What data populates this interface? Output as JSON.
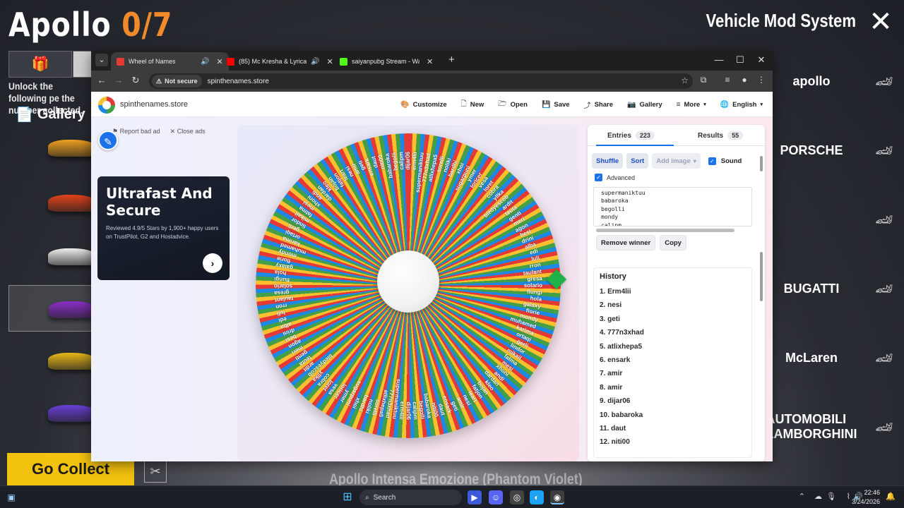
{
  "game": {
    "title_name": "Apollo",
    "title_progress": "0/7",
    "system_title": "Vehicle Mod System",
    "unlock_note": "Unlock the following pe the number collected.",
    "gallery_label": "Gallery",
    "collect_button": "Go Collect",
    "car_caption": "Apollo Intensa Emozione (Phantom Violet)",
    "car_colors": [
      "#f0a020",
      "#e2421b",
      "#eeeeee",
      "#8b2fc9",
      "#e8b81a",
      "#6a3fd8"
    ],
    "brands": [
      {
        "name": "apollo",
        "icon": "apollo-logo-icon"
      },
      {
        "name": "PORSCHE",
        "icon": "porsche-crest-icon"
      },
      {
        "name": "",
        "icon": "transformer-logo-icon"
      },
      {
        "name": "BUGATTI",
        "icon": "bugatti-logo-icon"
      },
      {
        "name": "McLaren",
        "icon": "mclaren-logo-icon"
      },
      {
        "name": "AUTOMOBILI LAMBORGHINI",
        "icon": "lamborghini-crest-icon"
      }
    ]
  },
  "browser": {
    "tabs": [
      {
        "title": "Wheel of Names",
        "favicon_color": "#e53935",
        "audio": true,
        "active": true
      },
      {
        "title": "(85) Mc Kresha & Lyrical Son",
        "favicon_color": "#ff0000",
        "audio": true,
        "active": false
      },
      {
        "title": "saiyanpubg Stream - Watch Live",
        "favicon_color": "#53fc18",
        "audio": false,
        "active": false
      }
    ],
    "security_label": "Not secure",
    "url": "spinthenames.store"
  },
  "site": {
    "name": "spinthenames.store",
    "nav": [
      {
        "label": "Customize",
        "icon": "palette-icon",
        "glyph": "🎨"
      },
      {
        "label": "New",
        "icon": "new-file-icon",
        "glyph": "🗋"
      },
      {
        "label": "Open",
        "icon": "folder-open-icon",
        "glyph": "🗁"
      },
      {
        "label": "Save",
        "icon": "save-icon",
        "glyph": "💾"
      },
      {
        "label": "Share",
        "icon": "share-icon",
        "glyph": "⤴"
      },
      {
        "label": "Gallery",
        "icon": "camera-icon",
        "glyph": "📷"
      },
      {
        "label": "More",
        "icon": "menu-icon",
        "glyph": "≡"
      },
      {
        "label": "English",
        "icon": "globe-icon",
        "glyph": "🌐"
      }
    ],
    "ad": {
      "report": "Report bad ad",
      "close": "Close ads",
      "title": "Ultrafast And Secure",
      "description": "Reviewed 4.9/5 Stars by 1,900+ happy users on TrustPilot, G2 and Hostadvice."
    },
    "wheel_segment_colors": [
      "#e53935",
      "#fbc02d",
      "#43a047",
      "#1e88e5"
    ],
    "wheel_names": [
      "solario",
      "flungi",
      "hola",
      "galaxy",
      "florie",
      "mondy",
      "muhamed",
      "karima",
      "ortaqi",
      "gerli",
      "lindor",
      "mikail",
      "fatma",
      "mesi",
      "xhoni",
      "andi",
      "dardan",
      "kleo",
      "bojan",
      "fatjon",
      "leart",
      "nesi",
      "amir",
      "geti",
      "ensark",
      "daut",
      "niti00",
      "babaroka",
      "begolli",
      "calipm",
      "dijar06",
      "erm4lii",
      "supermaniktuu",
      "777n3xhad",
      "atlixhepa5",
      "sorelli",
      "noliki",
      "bardhi",
      "xhoi",
      "sugarpuni",
      "ymer",
      "loricer",
      "vesa",
      "loret",
      "cobra",
      "yllka",
      "bledyescob",
      "ardit",
      "teuta",
      "genti",
      "meri",
      "agon",
      "besi",
      "drini",
      "alba",
      "edi",
      "luli",
      "rron",
      "taulant",
      "gresa"
    ],
    "panel": {
      "entries_tab": "Entries",
      "entries_count": "223",
      "results_tab": "Results",
      "results_count": "55",
      "shuffle": "Shuffle",
      "sort": "Sort",
      "add_image": "Add image",
      "sound": "Sound",
      "advanced": "Advanced",
      "entries_visible": [
        "supermaniktuu",
        "babaroka",
        "begolli",
        "mondy",
        "calipm"
      ],
      "remove_winner": "Remove winner",
      "copy": "Copy",
      "history_title": "History",
      "history": [
        "1. Erm4lii",
        "2. nesi",
        "3. geti",
        "4. 777n3xhad",
        "5. atlixhepa5",
        "6. ensark",
        "7. amir",
        "8. amir",
        "9. dijar06",
        "10. babaroka",
        "11. daut",
        "12. niti00"
      ]
    }
  },
  "taskbar": {
    "search_label": "Search",
    "time": "22:46",
    "date": "3/24/2026"
  }
}
